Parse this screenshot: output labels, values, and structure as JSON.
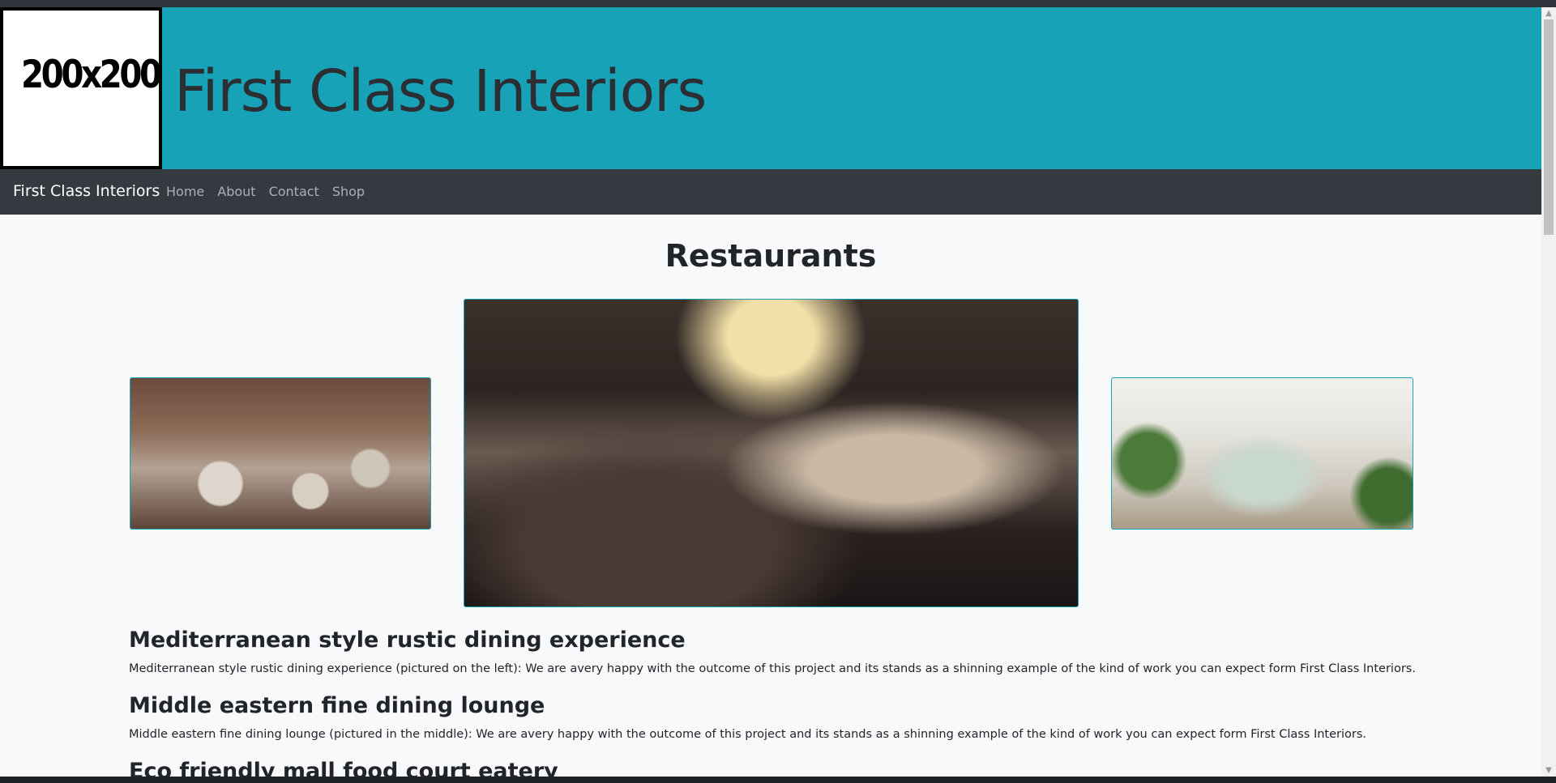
{
  "header": {
    "logo_text": "200x200",
    "site_title": "First Class Interiors"
  },
  "navbar": {
    "brand": "First Class Interiors",
    "links": [
      "Home",
      "About",
      "Contact",
      "Shop"
    ]
  },
  "page": {
    "heading": "Restaurants",
    "sections": [
      {
        "title": "Mediterranean style rustic dining experience",
        "text": "Mediterranean style rustic dining experience (pictured on the left): We are avery happy with the outcome of this project and its stands as a shinning example of the kind of work you can expect form First Class Interiors."
      },
      {
        "title": "Middle eastern fine dining lounge",
        "text": "Middle eastern fine dining lounge (pictured in the middle): We are avery happy with the outcome of this project and its stands as a shinning example of the kind of work you can expect form First Class Interiors."
      },
      {
        "title": "Eco friendly mall food court eatery"
      }
    ]
  },
  "colors": {
    "header_bg": "#17a2b8",
    "navbar_bg": "#343a40",
    "page_bg": "#f8f9fa"
  },
  "icons": {
    "scroll_up": "scroll-up-arrow-icon",
    "scroll_down": "scroll-down-arrow-icon"
  }
}
